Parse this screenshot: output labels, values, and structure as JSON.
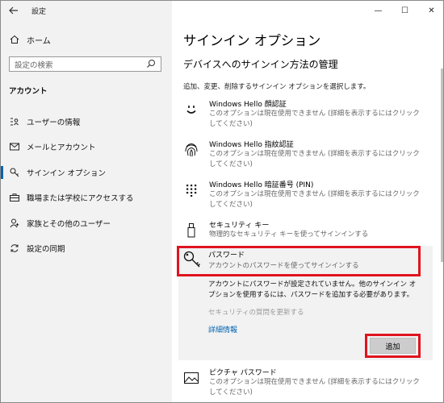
{
  "app_title": "設定",
  "window_controls": {
    "minimize": "—",
    "maximize": "☐",
    "close": "✕"
  },
  "sidebar": {
    "home": "ホーム",
    "search_placeholder": "設定の検索",
    "section": "アカウント",
    "items": [
      {
        "label": "ユーザーの情報",
        "icon": "user-info-icon"
      },
      {
        "label": "メールとアカウント",
        "icon": "mail-icon"
      },
      {
        "label": "サインイン オプション",
        "icon": "key-icon",
        "active": true
      },
      {
        "label": "職場または学校にアクセスする",
        "icon": "briefcase-icon"
      },
      {
        "label": "家族とその他のユーザー",
        "icon": "person-add-icon"
      },
      {
        "label": "設定の同期",
        "icon": "sync-icon"
      }
    ]
  },
  "main": {
    "title": "サインイン オプション",
    "subtitle": "デバイスへのサインイン方法の管理",
    "intro": "追加、変更、削除するサインイン オプションを選択します。",
    "options": [
      {
        "name": "Windows Hello 顔認証",
        "desc": "このオプションは現在使用できません (詳細を表示するにはクリックしてください)",
        "icon": "face-icon"
      },
      {
        "name": "Windows Hello 指紋認証",
        "desc": "このオプションは現在使用できません (詳細を表示するにはクリックしてください)",
        "icon": "fingerprint-icon"
      },
      {
        "name": "Windows Hello 暗証番号 (PIN)",
        "desc": "このオプションは現在使用できません (詳細を表示するにはクリックしてください)",
        "icon": "pin-keypad-icon"
      },
      {
        "name": "セキュリティ キー",
        "desc": "物理的なセキュリティ キーを使ってサインインする",
        "icon": "usb-key-icon"
      }
    ],
    "password": {
      "name": "パスワード",
      "desc": "アカウントのパスワードを使ってサインインする",
      "message": "アカウントにパスワードが設定されていません。他のサインイン オプションを使用するには、パスワードを追加する必要があります。",
      "security_question": "セキュリティの質問を更新する",
      "more_info": "詳細情報",
      "add_button": "追加"
    },
    "picture_password": {
      "name": "ピクチャ パスワード",
      "desc": "このオプションは現在使用できません (詳細を表示するにはクリックしてください)",
      "icon": "picture-icon"
    }
  },
  "colors": {
    "highlight": "#e0141e",
    "link": "#0063b1",
    "sidebar_bg": "#f2f2f2"
  }
}
